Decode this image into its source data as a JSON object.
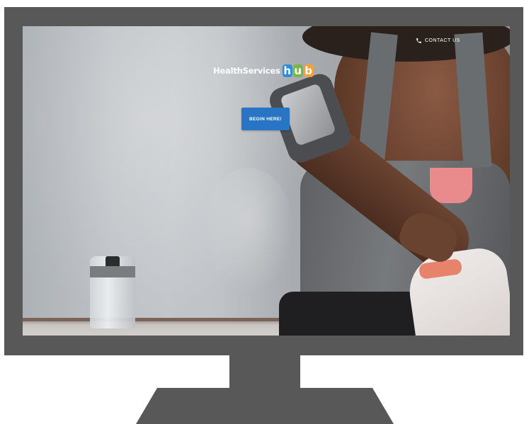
{
  "header": {
    "contact_label": "CONTACT US",
    "contact_icon": "phone-icon"
  },
  "logo": {
    "text": "HealthServices",
    "hub_letters": [
      {
        "letter": "h",
        "color": "#2f8fd6"
      },
      {
        "letter": "u",
        "color": "#7ab648"
      },
      {
        "letter": "b",
        "color": "#f0a23b"
      }
    ]
  },
  "hero": {
    "cta_label": "BEGIN HERE!"
  },
  "colors": {
    "bezel": "#585858",
    "cta": "#2775c4"
  }
}
